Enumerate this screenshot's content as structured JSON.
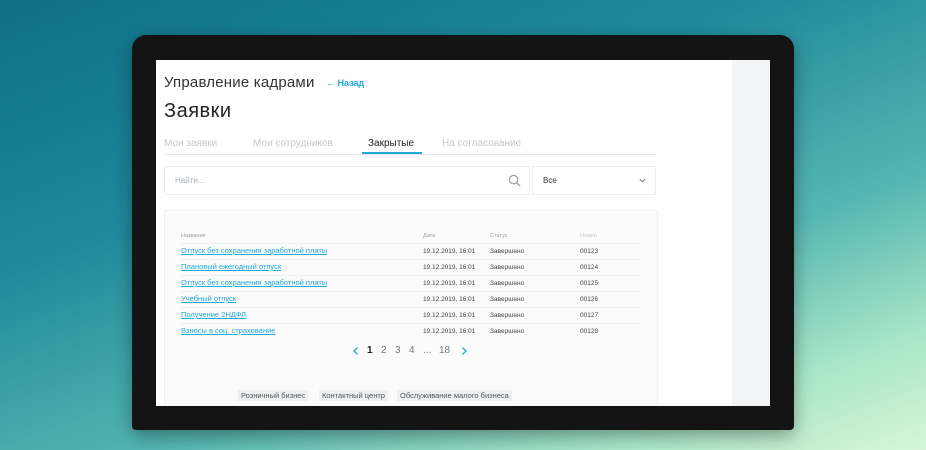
{
  "header": {
    "module_title": "Управление кадрами",
    "back_link": "← Назад",
    "page_title": "Заявки"
  },
  "tabs": [
    {
      "label": "Мои заявки"
    },
    {
      "label": "Мои сотрудников"
    },
    {
      "label": "Закрытые"
    },
    {
      "label": "На согласование"
    }
  ],
  "active_tab": "Закрытые",
  "search": {
    "placeholder": "Найти...",
    "value": ""
  },
  "filter": {
    "value": "Все"
  },
  "table": {
    "columns": {
      "name": "Название",
      "date": "Дата",
      "status": "Статус",
      "number": "Номер"
    },
    "rows": [
      {
        "name": "Отпуск без сохранения заработной платы",
        "date": "19.12.2019, 16:01",
        "status": "Завершено",
        "number": "00123"
      },
      {
        "name": "Плановый ежегодный отпуск",
        "date": "19.12.2019, 16:01",
        "status": "Завершено",
        "number": "00124"
      },
      {
        "name": "Отпуск без сохранения заработной платы",
        "date": "19.12.2019, 16:01",
        "status": "Завершено",
        "number": "00125"
      },
      {
        "name": "Учебный отпуск",
        "date": "19.12.2019, 16:01",
        "status": "Завершено",
        "number": "00126"
      },
      {
        "name": "Получение 2НДФЛ",
        "date": "19.12.2019, 16:01",
        "status": "Завершено",
        "number": "00127"
      },
      {
        "name": "Взносы в соц. страхование",
        "date": "19.12.2019, 16:01",
        "status": "Завершено",
        "number": "00128"
      }
    ]
  },
  "pagination": {
    "pages": [
      "1",
      "2",
      "3",
      "4",
      "...",
      "18"
    ],
    "current": "1"
  },
  "footer_tags": [
    "Розничный бизнес",
    "Контактный центр",
    "Обслуживание малого бизнеса"
  ],
  "colors": {
    "accent": "#1fa9d8",
    "text": "#222222",
    "muted": "#c5c9cd"
  },
  "icons": {
    "search": "search-icon",
    "chevron": "chevron-down-icon",
    "prev": "chevron-left-icon",
    "next": "chevron-right-icon"
  }
}
